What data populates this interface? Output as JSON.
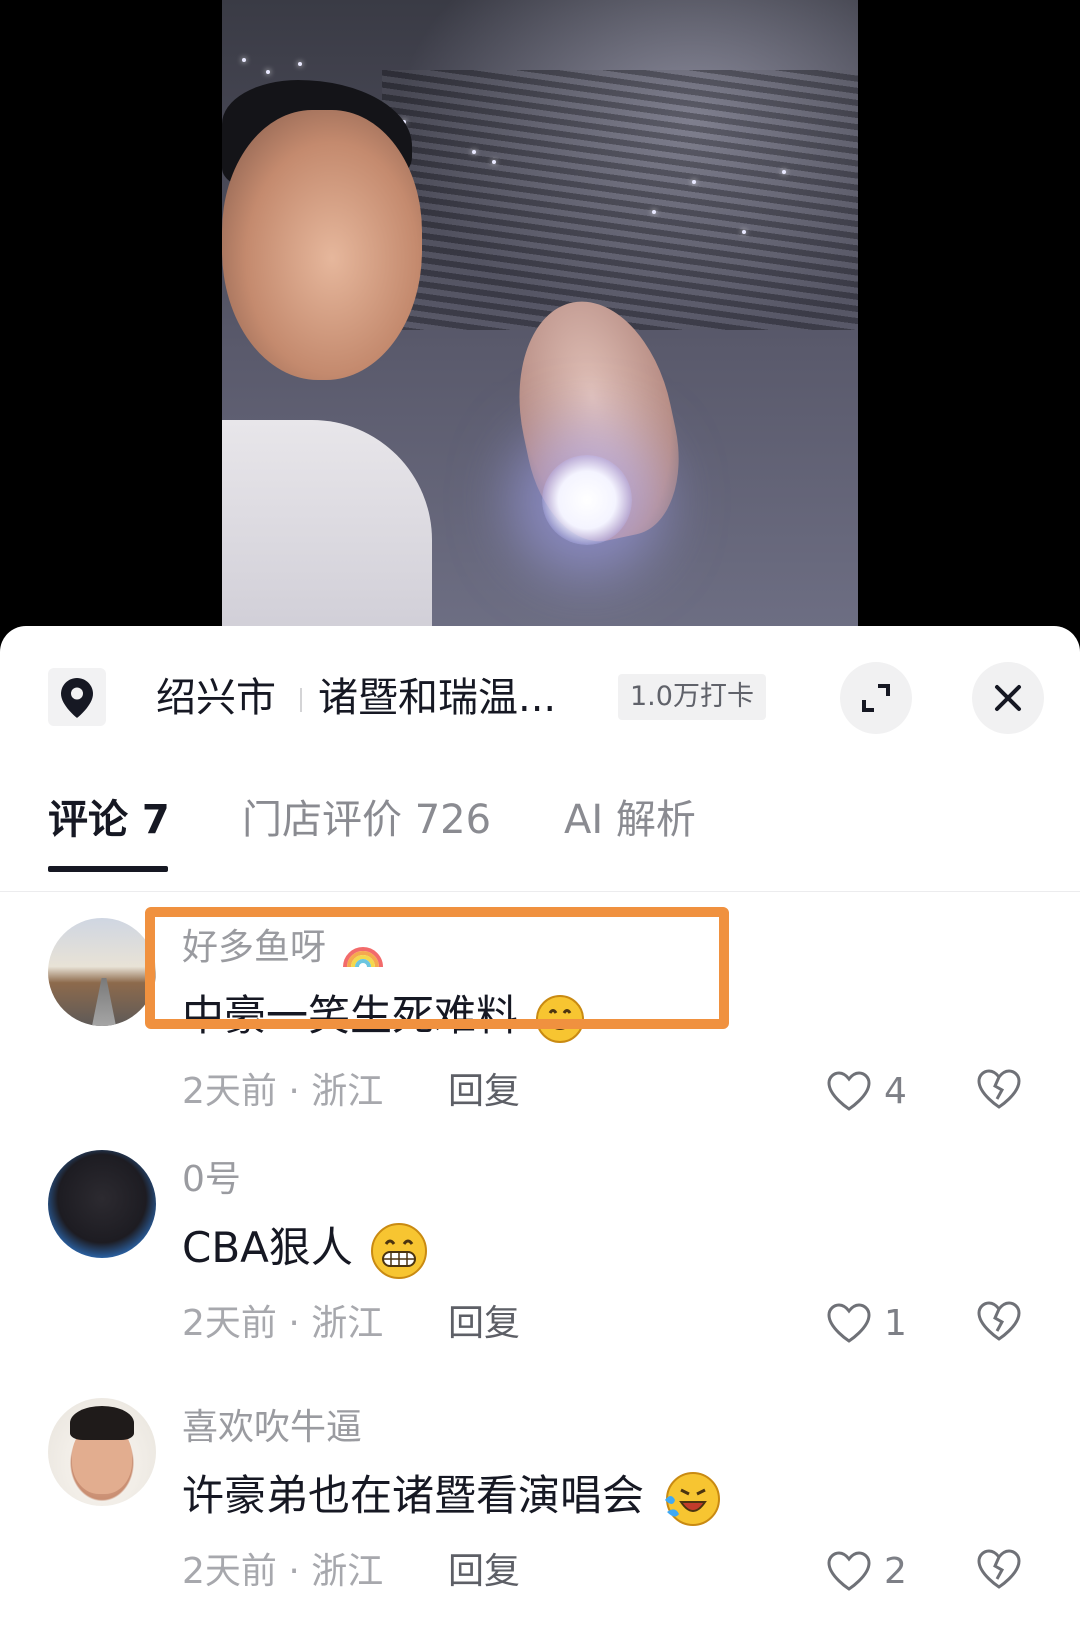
{
  "location": {
    "city": "绍兴市",
    "place": "诸暨和瑞温...",
    "checkins": "1.0万打卡"
  },
  "tabs": [
    {
      "label": "评论 7"
    },
    {
      "label": "门店评价 726"
    },
    {
      "label": "AI 解析"
    }
  ],
  "comments": [
    {
      "username": "好多鱼呀",
      "text": "中豪一笑生死难料",
      "time": "2天前",
      "region": "浙江",
      "reply_label": "回复",
      "likes": "4"
    },
    {
      "username": "0号",
      "text": "CBA狠人",
      "time": "2天前",
      "region": "浙江",
      "reply_label": "回复",
      "likes": "1"
    },
    {
      "username": "喜欢吹牛逼",
      "text": "许豪弟也在诸暨看演唱会",
      "time": "2天前",
      "region": "浙江",
      "reply_label": "回复",
      "likes": "2"
    }
  ],
  "meta_separator": "·",
  "colors": {
    "highlight": "#f0913f",
    "text_primary": "#161823",
    "text_secondary": "#9a9ba0"
  },
  "icons": [
    "location-pin-icon",
    "expand-icon",
    "close-icon",
    "heart-icon",
    "broken-heart-icon",
    "rainbow-emoji",
    "grin-emoji",
    "big-grin-emoji",
    "laugh-cry-emoji"
  ]
}
